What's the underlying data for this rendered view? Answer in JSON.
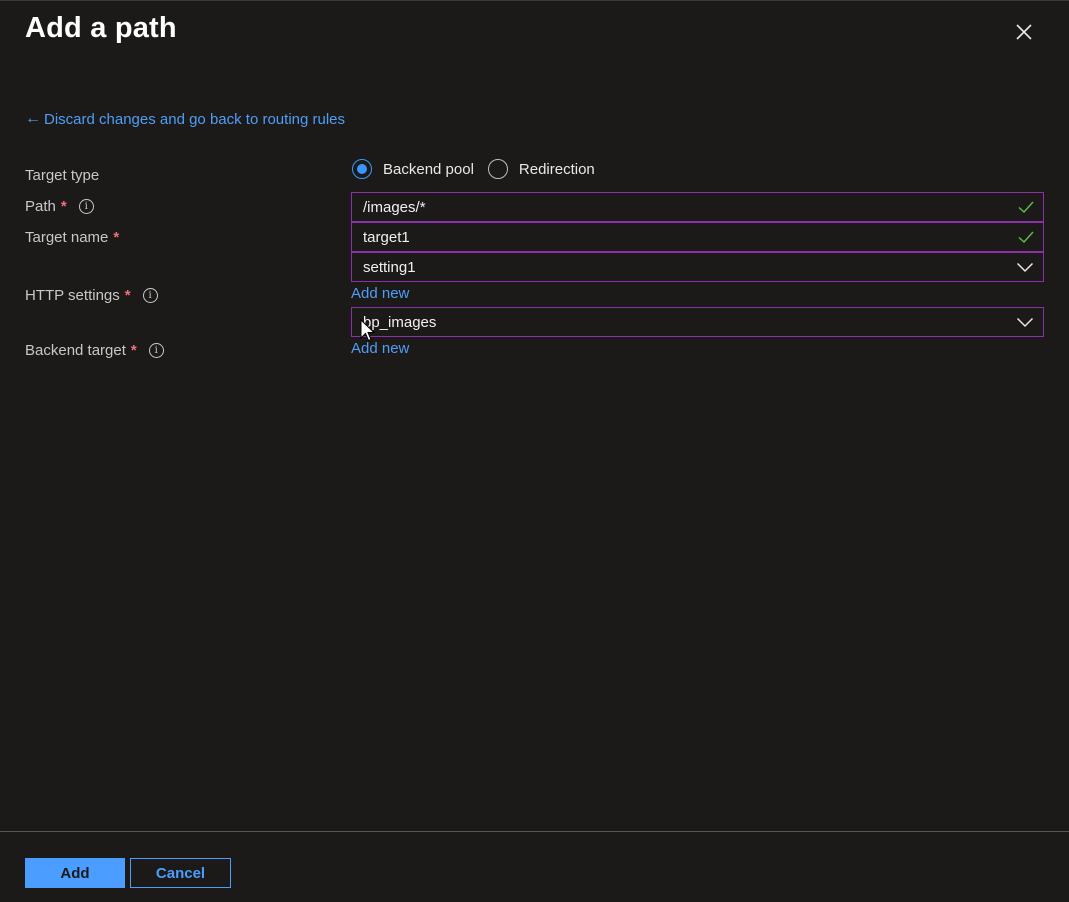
{
  "header": {
    "title": "Add a path",
    "close_icon": "close-icon"
  },
  "back_link": {
    "arrow": "←",
    "label": "Discard changes and go back to routing rules"
  },
  "form": {
    "target_type": {
      "label": "Target type",
      "options": [
        {
          "label": "Backend pool",
          "selected": true
        },
        {
          "label": "Redirection",
          "selected": false
        }
      ]
    },
    "path": {
      "label": "Path",
      "required_mark": "*",
      "value": "/images/*",
      "valid": true
    },
    "target_name": {
      "label": "Target name",
      "required_mark": "*",
      "value": "target1",
      "valid": true
    },
    "http_settings": {
      "label": "HTTP settings",
      "required_mark": "*",
      "value": "setting1",
      "add_new": "Add new"
    },
    "backend_target": {
      "label": "Backend target",
      "required_mark": "*",
      "value": "bp_images",
      "add_new": "Add new"
    }
  },
  "footer": {
    "add_label": "Add",
    "cancel_label": "Cancel"
  },
  "colors": {
    "background": "#1b1a19",
    "accent": "#4b9dff",
    "field_border": "#8c2fa8",
    "valid_check": "#5fb94c",
    "required": "#f1707b"
  }
}
